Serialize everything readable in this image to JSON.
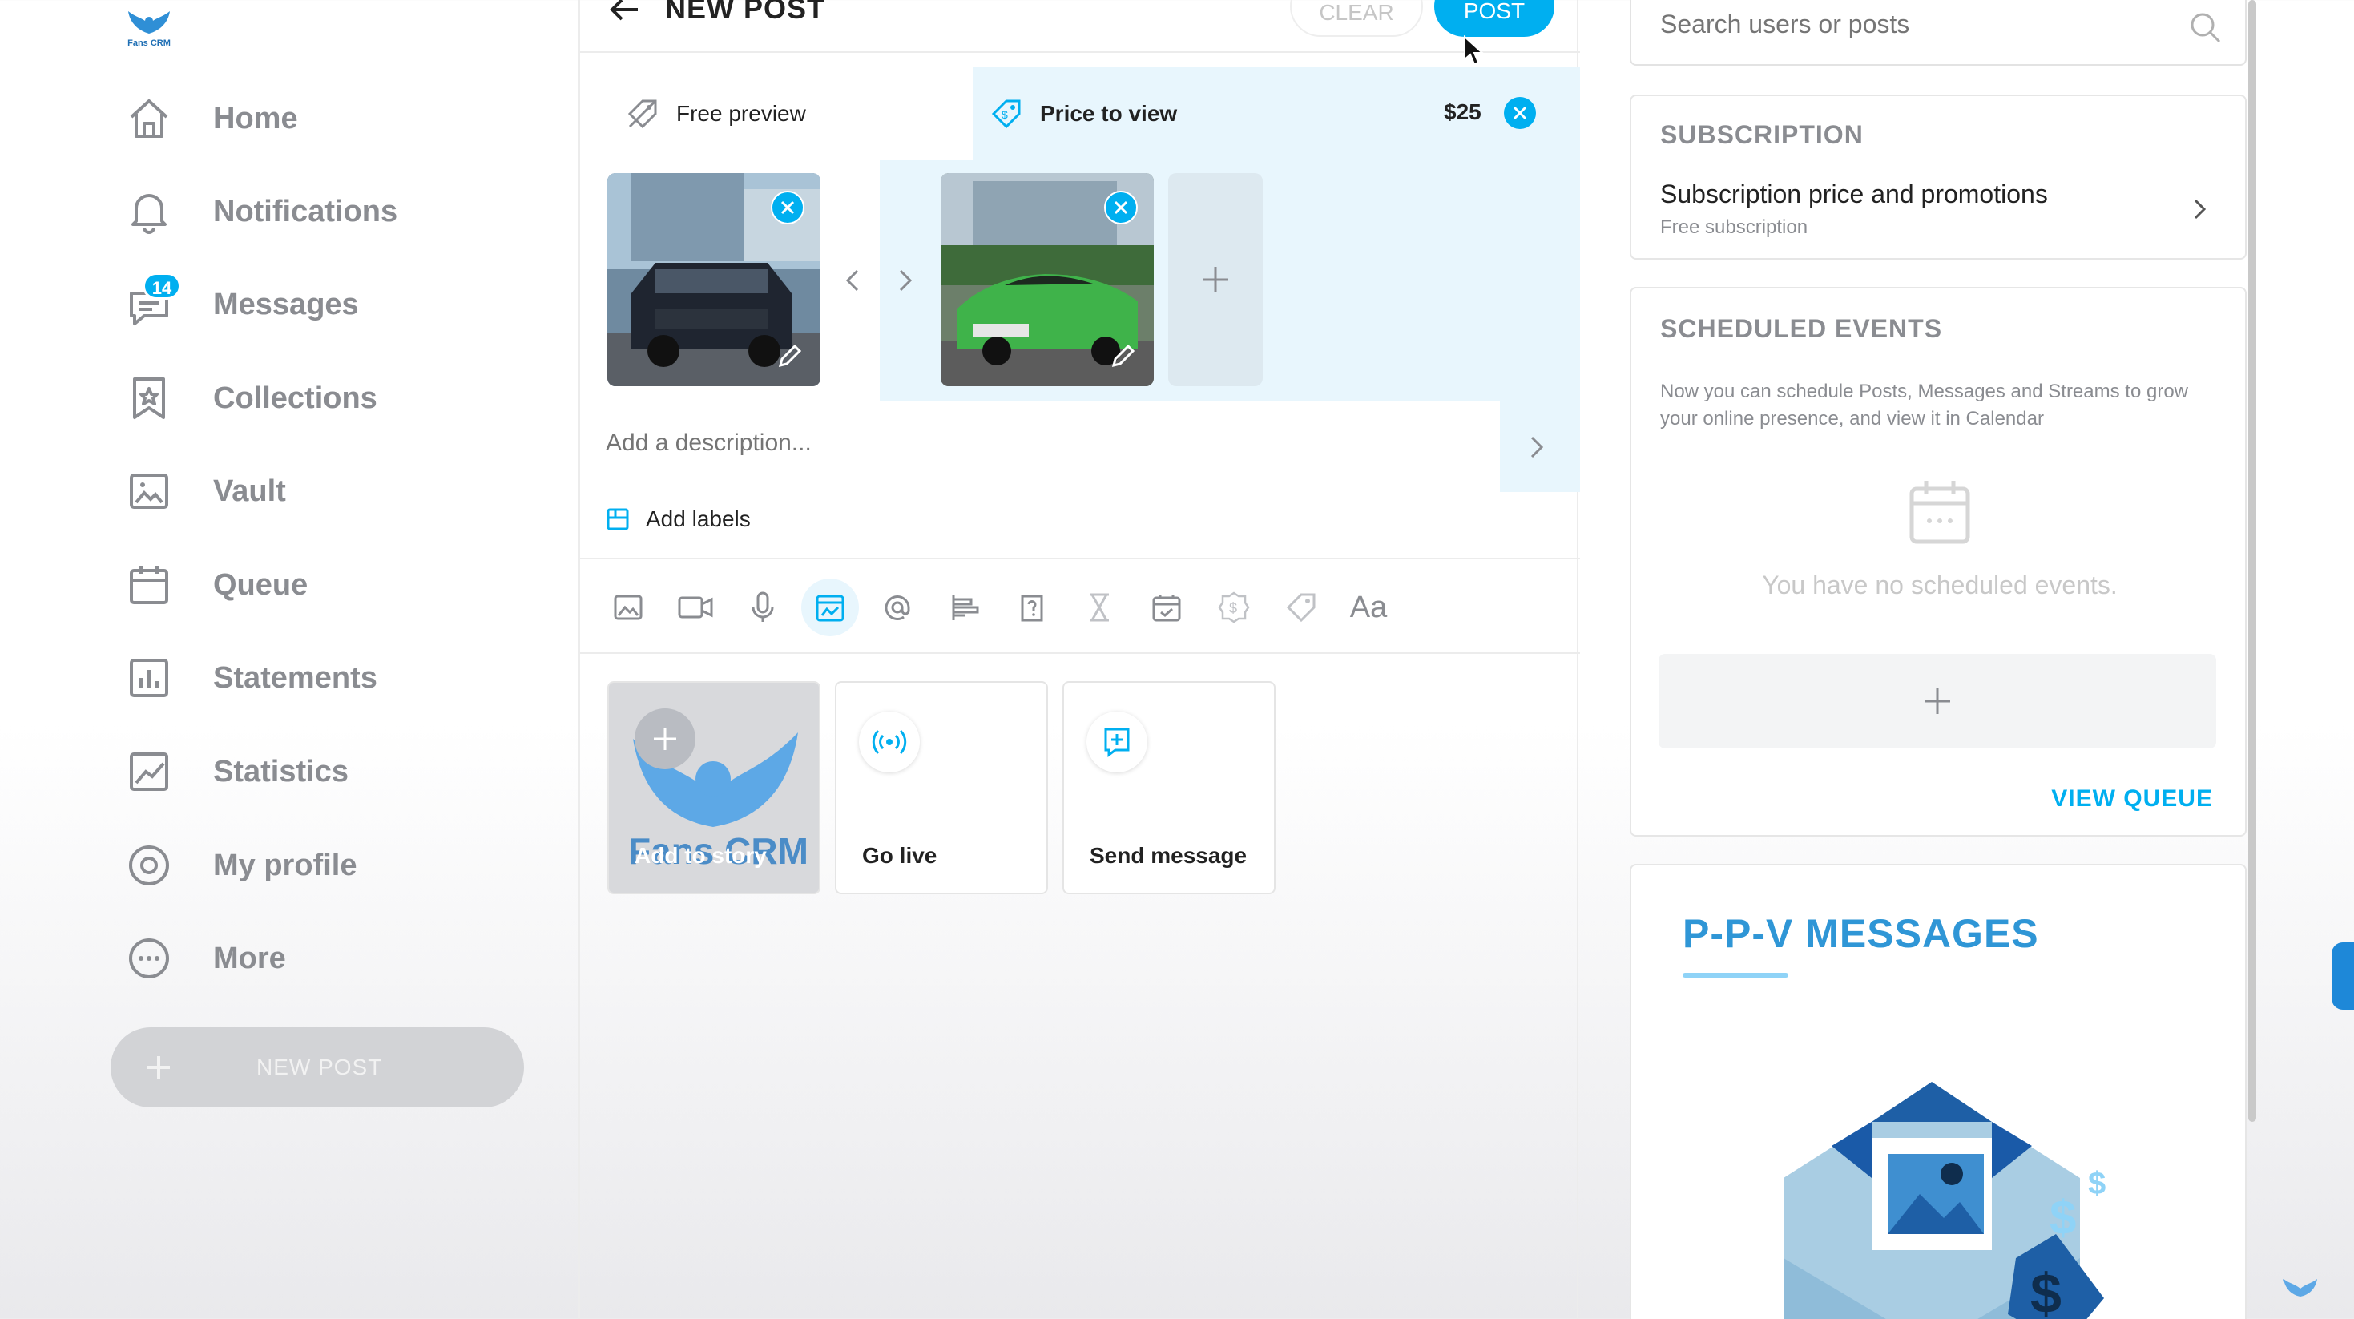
{
  "brand": {
    "name": "Fans CRM",
    "logo_text": "Fans CRM"
  },
  "sidebar": {
    "items": [
      {
        "label": "Home",
        "icon": "home-icon"
      },
      {
        "label": "Notifications",
        "icon": "bell-icon"
      },
      {
        "label": "Messages",
        "icon": "chat-icon",
        "badge": "14"
      },
      {
        "label": "Collections",
        "icon": "bookmark-star-icon"
      },
      {
        "label": "Vault",
        "icon": "image-icon"
      },
      {
        "label": "Queue",
        "icon": "calendar-icon"
      },
      {
        "label": "Statements",
        "icon": "bar-chart-icon"
      },
      {
        "label": "Statistics",
        "icon": "line-chart-icon"
      },
      {
        "label": "My profile",
        "icon": "user-circle-icon"
      },
      {
        "label": "More",
        "icon": "more-dots-icon"
      }
    ],
    "new_post_label": "NEW POST"
  },
  "composer": {
    "title": "NEW POST",
    "clear_label": "CLEAR",
    "post_label": "POST",
    "free_preview_label": "Free preview",
    "price_to_view_label": "Price to view",
    "price": "$25",
    "description_placeholder": "Add a description...",
    "add_labels": "Add labels",
    "toolbar_text_tool": "Aa",
    "actions": [
      {
        "label": "Add to story",
        "icon": "plus-icon"
      },
      {
        "label": "Go live",
        "icon": "broadcast-icon"
      },
      {
        "label": "Send message",
        "icon": "add-message-icon"
      }
    ]
  },
  "search": {
    "placeholder": "Search users or posts"
  },
  "subscription": {
    "heading": "SUBSCRIPTION",
    "title": "Subscription price and promotions",
    "caption": "Free subscription"
  },
  "scheduled": {
    "heading": "SCHEDULED EVENTS",
    "description": "Now you can schedule Posts, Messages and Streams to grow your online presence, and view it in Calendar",
    "empty_text": "You have no scheduled events.",
    "view_queue_label": "VIEW QUEUE"
  },
  "ppv": {
    "title": "P-P-V  MESSAGES"
  },
  "colors": {
    "accent": "#00aff0",
    "accent_light": "#e8f6fd",
    "muted": "#8a8c91"
  }
}
